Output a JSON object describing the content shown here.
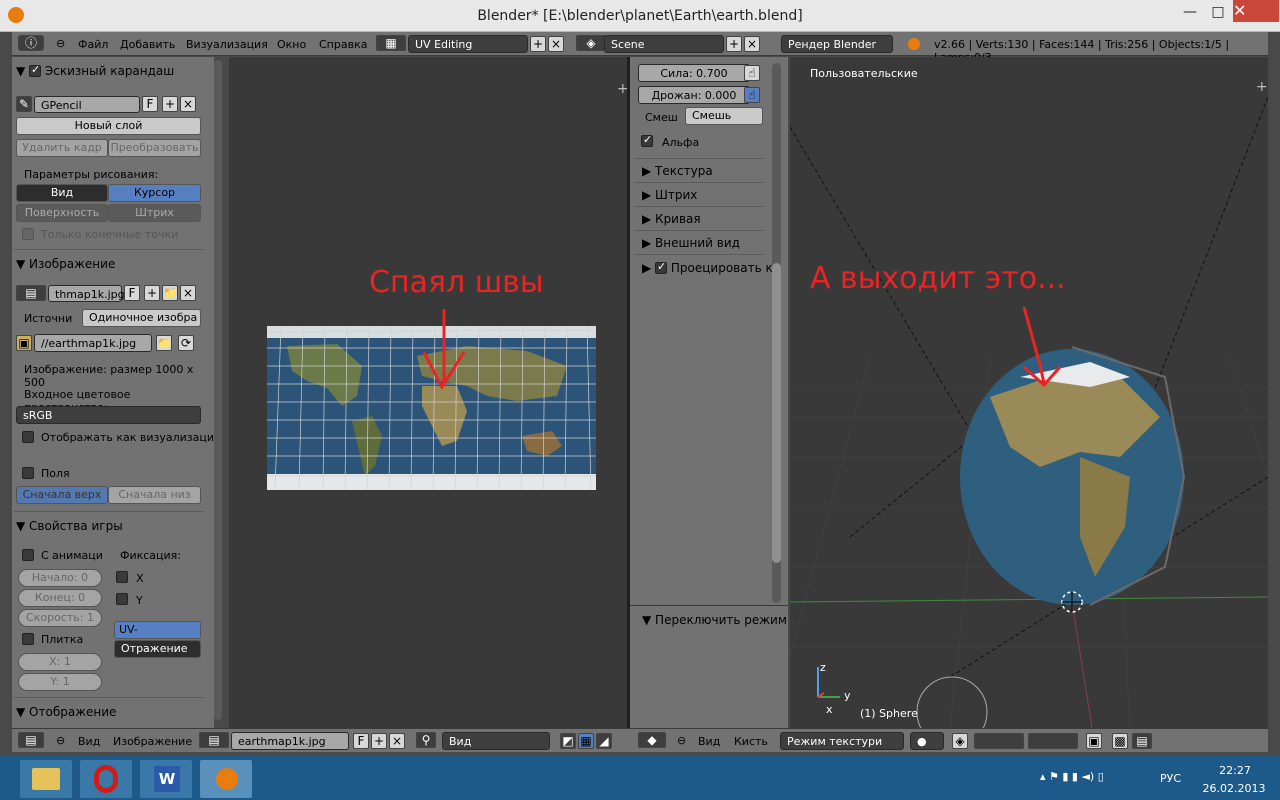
{
  "window": {
    "title": "Blender* [E:\\blender\\planet\\Earth\\earth.blend]",
    "min": "—",
    "max": "□",
    "close": "✕"
  },
  "menu": {
    "file": "Файл",
    "add": "Добавить",
    "render": "Визуализация",
    "window": "Окно",
    "help": "Справка"
  },
  "screen": {
    "layout": "UV Editing",
    "scene": "Scene",
    "engine": "Рендер Blender",
    "stats": "v2.66 | Verts:130 | Faces:144 | Tris:256 | Objects:1/5 | Lamps:0/3"
  },
  "left_panel": {
    "gp_header": "Эскизный карандаш",
    "gp_name": "GPencil",
    "gp_f": "F",
    "new_layer": "Новый слой",
    "delete_frame": "Удалить кадр",
    "convert": "Преобразовать",
    "draw_params": "Параметры рисования:",
    "view": "Вид",
    "cursor": "Курсор",
    "surface": "Поверхность",
    "stroke": "Штрих",
    "endpoints": "Только конечные точки",
    "image_header": "Изображение",
    "image_name": "thmap1k.jpg",
    "image_f": "F",
    "source_label": "Источни",
    "source_value": "Одиночное изобра",
    "filepath": "//earthmap1k.jpg",
    "image_size": "Изображение: размер 1000 x 500",
    "colorspace_label": "Входное цветовое пространство:",
    "colorspace": "sRGB",
    "show_as_render": "Отображать как визуализаци",
    "fields": "Поля",
    "upper_first": "Сначала верх",
    "lower_first": "Сначала низ",
    "game_header": "Свойства игры",
    "animated": "С анимаци",
    "clamp": "Фиксация:",
    "clamp_x": "X",
    "clamp_y": "Y",
    "start": "Начало: 0",
    "end": "Конец: 0",
    "speed": "Скорость: 1",
    "tiles": "Плитка",
    "tile_x": "X: 1",
    "tile_y": "Y: 1",
    "uv_coords": "UV-координат",
    "reflection": "Отражение",
    "display_header": "Отображение"
  },
  "uv_annotation": "Спаял швы",
  "view_annotation": "А выходит это...",
  "properties": {
    "strength": "Сила: 0.700",
    "jitter": "Дрожан: 0.000",
    "blend_label": "Смеш",
    "blend_value": "Смешь",
    "alpha": "Альфа",
    "texture": "Текстура",
    "stroke": "Штрих",
    "curve": "Кривая",
    "appearance": "Внешний вид",
    "project": "Проецировать к",
    "toggle_mode": "Переключить режим р"
  },
  "view3d": {
    "title": "Пользовательские",
    "object": "(1) Sphere",
    "axis_x": "x",
    "axis_y": "y",
    "axis_z": "z"
  },
  "bottom": {
    "view": "Вид",
    "image": "Изображение",
    "image_file": "earthmap1k.jpg",
    "f": "F",
    "view_mode": "Вид",
    "view2": "Вид",
    "brush": "Кисть",
    "texture_mode": "Режим текстури"
  },
  "taskbar": {
    "lang": "РУС",
    "time": "22:27",
    "date": "26.02.2013"
  }
}
